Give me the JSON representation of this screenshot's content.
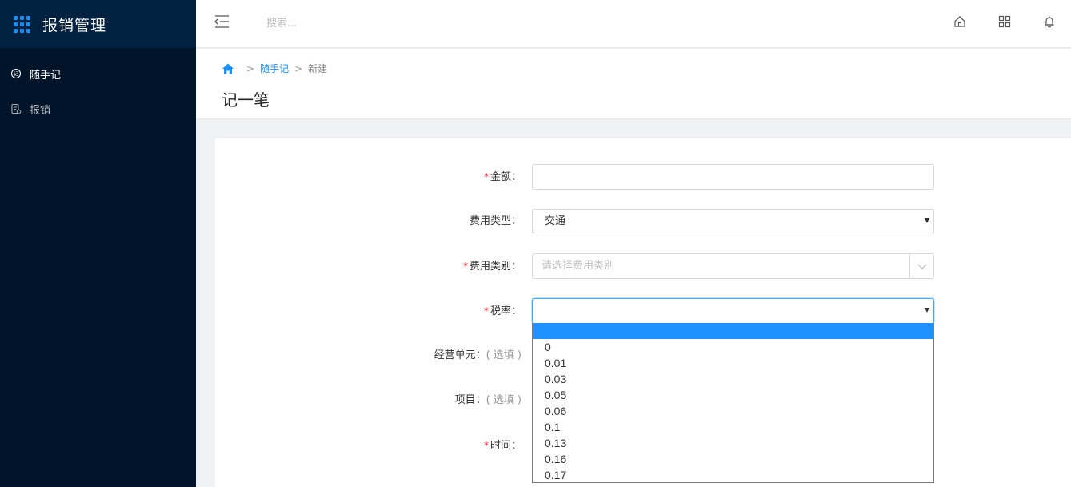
{
  "app": {
    "title": "报销管理"
  },
  "sidebar": {
    "items": [
      {
        "label": "随手记",
        "icon": "memo-icon",
        "active": true
      },
      {
        "label": "报销",
        "icon": "document-icon",
        "active": false
      }
    ]
  },
  "topbar": {
    "search_placeholder": "搜索...",
    "icons": [
      "home-icon",
      "apps-icon",
      "bell-icon"
    ]
  },
  "breadcrumb": {
    "items": [
      "随手记",
      "新建"
    ]
  },
  "page": {
    "title": "记一笔"
  },
  "form": {
    "amount": {
      "label": "金额：",
      "required": true,
      "value": ""
    },
    "expense_type": {
      "label": "费用类型：",
      "required": false,
      "value": "交通"
    },
    "expense_category": {
      "label": "费用类别：",
      "required": true,
      "placeholder": "请选择费用类别"
    },
    "tax_rate": {
      "label": "税率：",
      "required": true,
      "value": ""
    },
    "business_unit": {
      "label": "经营单元：",
      "optional_text": "( 选填 )"
    },
    "project": {
      "label": "项目：",
      "optional_text": "( 选填 )"
    },
    "time": {
      "label": "时间：",
      "required": true
    }
  },
  "tax_rate_options": [
    "",
    "0",
    "0.01",
    "0.03",
    "0.05",
    "0.06",
    "0.1",
    "0.13",
    "0.16",
    "0.17"
  ],
  "colors": {
    "sidebar_bg": "#001529",
    "brand_bg": "#002140",
    "accent": "#1890ff",
    "required": "#f5222d"
  }
}
